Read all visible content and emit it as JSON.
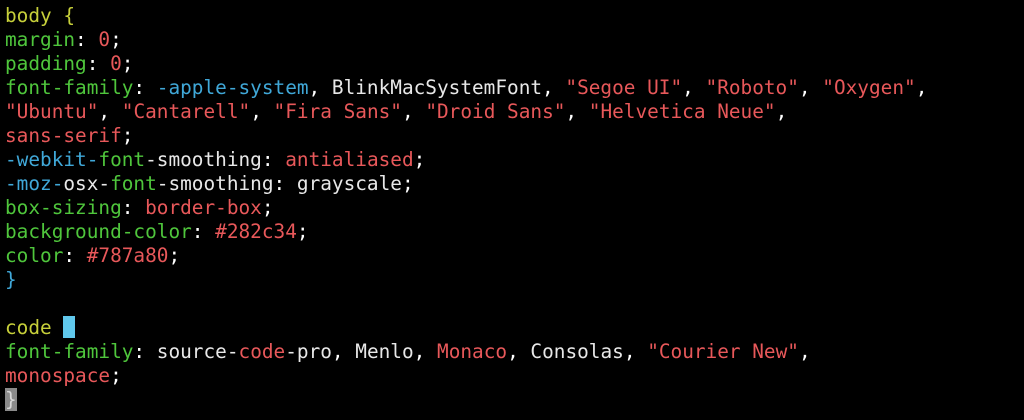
{
  "colors": {
    "background": "#000000",
    "selector": "#c7d03a",
    "property": "#4fc63c",
    "punctuation": "#ffffff",
    "value_string": "#e8585a",
    "value_plain": "#e8e8e8",
    "prefix": "#40a8d8",
    "brace": "#40a8d8",
    "cursor": "#60c8ec"
  },
  "lines": [
    [
      {
        "t": "body {",
        "c": "selector"
      }
    ],
    [
      {
        "t": "margin",
        "c": "property"
      },
      {
        "t": ": ",
        "c": "punctuation"
      },
      {
        "t": "0",
        "c": "value_string"
      },
      {
        "t": ";",
        "c": "punctuation"
      }
    ],
    [
      {
        "t": "padding",
        "c": "property"
      },
      {
        "t": ": ",
        "c": "punctuation"
      },
      {
        "t": "0",
        "c": "value_string"
      },
      {
        "t": ";",
        "c": "punctuation"
      }
    ],
    [
      {
        "t": "font-family",
        "c": "property"
      },
      {
        "t": ": ",
        "c": "punctuation"
      },
      {
        "t": "-apple-system",
        "c": "prefix"
      },
      {
        "t": ", ",
        "c": "punctuation"
      },
      {
        "t": "BlinkMacSystemFont",
        "c": "value_plain"
      },
      {
        "t": ", ",
        "c": "punctuation"
      },
      {
        "t": "\"Segoe UI\"",
        "c": "value_string"
      },
      {
        "t": ", ",
        "c": "punctuation"
      },
      {
        "t": "\"Roboto\"",
        "c": "value_string"
      },
      {
        "t": ", ",
        "c": "punctuation"
      },
      {
        "t": "\"Oxygen\"",
        "c": "value_string"
      },
      {
        "t": ",",
        "c": "punctuation"
      }
    ],
    [
      {
        "t": "\"Ubuntu\"",
        "c": "value_string"
      },
      {
        "t": ", ",
        "c": "punctuation"
      },
      {
        "t": "\"Cantarell\"",
        "c": "value_string"
      },
      {
        "t": ", ",
        "c": "punctuation"
      },
      {
        "t": "\"Fira Sans\"",
        "c": "value_string"
      },
      {
        "t": ", ",
        "c": "punctuation"
      },
      {
        "t": "\"Droid Sans\"",
        "c": "value_string"
      },
      {
        "t": ", ",
        "c": "punctuation"
      },
      {
        "t": "\"Helvetica Neue\"",
        "c": "value_string"
      },
      {
        "t": ",",
        "c": "punctuation"
      }
    ],
    [
      {
        "t": "sans-serif",
        "c": "value_string"
      },
      {
        "t": ";",
        "c": "punctuation"
      }
    ],
    [
      {
        "t": "-webkit-",
        "c": "prefix"
      },
      {
        "t": "font",
        "c": "property"
      },
      {
        "t": "-smoothing",
        "c": "value_plain"
      },
      {
        "t": ": ",
        "c": "punctuation"
      },
      {
        "t": "antialiased",
        "c": "value_string"
      },
      {
        "t": ";",
        "c": "punctuation"
      }
    ],
    [
      {
        "t": "-moz-",
        "c": "prefix"
      },
      {
        "t": "osx-",
        "c": "value_plain"
      },
      {
        "t": "font",
        "c": "property"
      },
      {
        "t": "-smoothing",
        "c": "value_plain"
      },
      {
        "t": ": ",
        "c": "punctuation"
      },
      {
        "t": "grayscale",
        "c": "value_plain"
      },
      {
        "t": ";",
        "c": "punctuation"
      }
    ],
    [
      {
        "t": "box-sizing",
        "c": "property"
      },
      {
        "t": ": ",
        "c": "punctuation"
      },
      {
        "t": "border-box",
        "c": "value_string"
      },
      {
        "t": ";",
        "c": "punctuation"
      }
    ],
    [
      {
        "t": "background-color",
        "c": "property"
      },
      {
        "t": ": ",
        "c": "punctuation"
      },
      {
        "t": "#282c34",
        "c": "value_string"
      },
      {
        "t": ";",
        "c": "punctuation"
      }
    ],
    [
      {
        "t": "color",
        "c": "property"
      },
      {
        "t": ": ",
        "c": "punctuation"
      },
      {
        "t": "#787a80",
        "c": "value_string"
      },
      {
        "t": ";",
        "c": "punctuation"
      }
    ],
    [
      {
        "t": "}",
        "c": "brace"
      }
    ],
    [],
    [
      {
        "t": "code ",
        "c": "selector"
      },
      {
        "cursor": true
      }
    ],
    [
      {
        "t": "font-family",
        "c": "property"
      },
      {
        "t": ": ",
        "c": "punctuation"
      },
      {
        "t": "source-",
        "c": "value_plain"
      },
      {
        "t": "code",
        "c": "value_string"
      },
      {
        "t": "-pro",
        "c": "value_plain"
      },
      {
        "t": ", ",
        "c": "punctuation"
      },
      {
        "t": "Menlo",
        "c": "value_plain"
      },
      {
        "t": ", ",
        "c": "punctuation"
      },
      {
        "t": "Monaco",
        "c": "value_string"
      },
      {
        "t": ", ",
        "c": "punctuation"
      },
      {
        "t": "Consolas",
        "c": "value_plain"
      },
      {
        "t": ", ",
        "c": "punctuation"
      },
      {
        "t": "\"Courier New\"",
        "c": "value_string"
      },
      {
        "t": ",",
        "c": "punctuation"
      }
    ],
    [
      {
        "t": "monospace",
        "c": "value_string"
      },
      {
        "t": ";",
        "c": "punctuation"
      }
    ],
    [
      {
        "t": "}",
        "c": "selector",
        "cursor_char": true
      }
    ]
  ]
}
